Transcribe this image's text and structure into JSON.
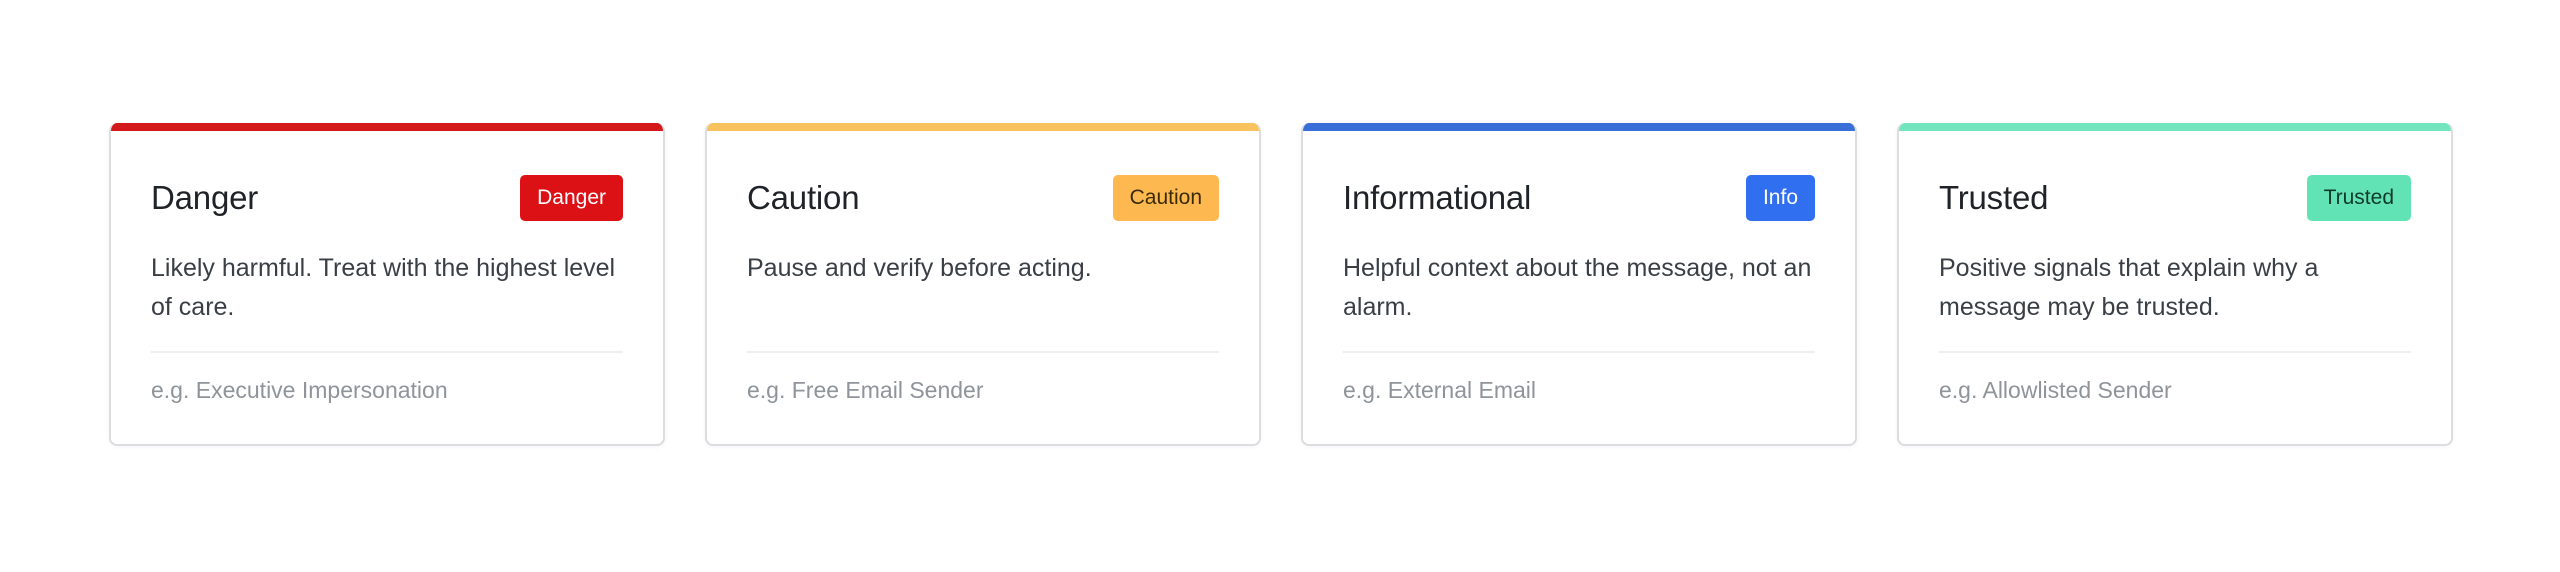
{
  "cards": [
    {
      "title": "Danger",
      "badge": "Danger",
      "description": "Likely harmful. Treat with the highest level of care.",
      "example": "e.g. Executive Impersonation",
      "accent_color": "#d4191c",
      "badge_bg": "#db1116",
      "badge_fg": "#ffffff"
    },
    {
      "title": "Caution",
      "badge": "Caution",
      "description": "Pause and verify before acting.",
      "example": "e.g. Free Email Sender",
      "accent_color": "#f8c35c",
      "badge_bg": "#fdb94f",
      "badge_fg": "#3a2a06"
    },
    {
      "title": "Informational",
      "badge": "Info",
      "description": "Helpful context about the message, not an alarm.",
      "example": "e.g. External Email",
      "accent_color": "#3a6fd8",
      "badge_bg": "#2f6ff0",
      "badge_fg": "#ffffff"
    },
    {
      "title": "Trusted",
      "badge": "Trusted",
      "description": "Positive signals that explain why a message may be trusted.",
      "example": "e.g. Allowlisted Sender",
      "accent_color": "#72e5bf",
      "badge_bg": "#62e3b6",
      "badge_fg": "#0f3a2c"
    }
  ]
}
